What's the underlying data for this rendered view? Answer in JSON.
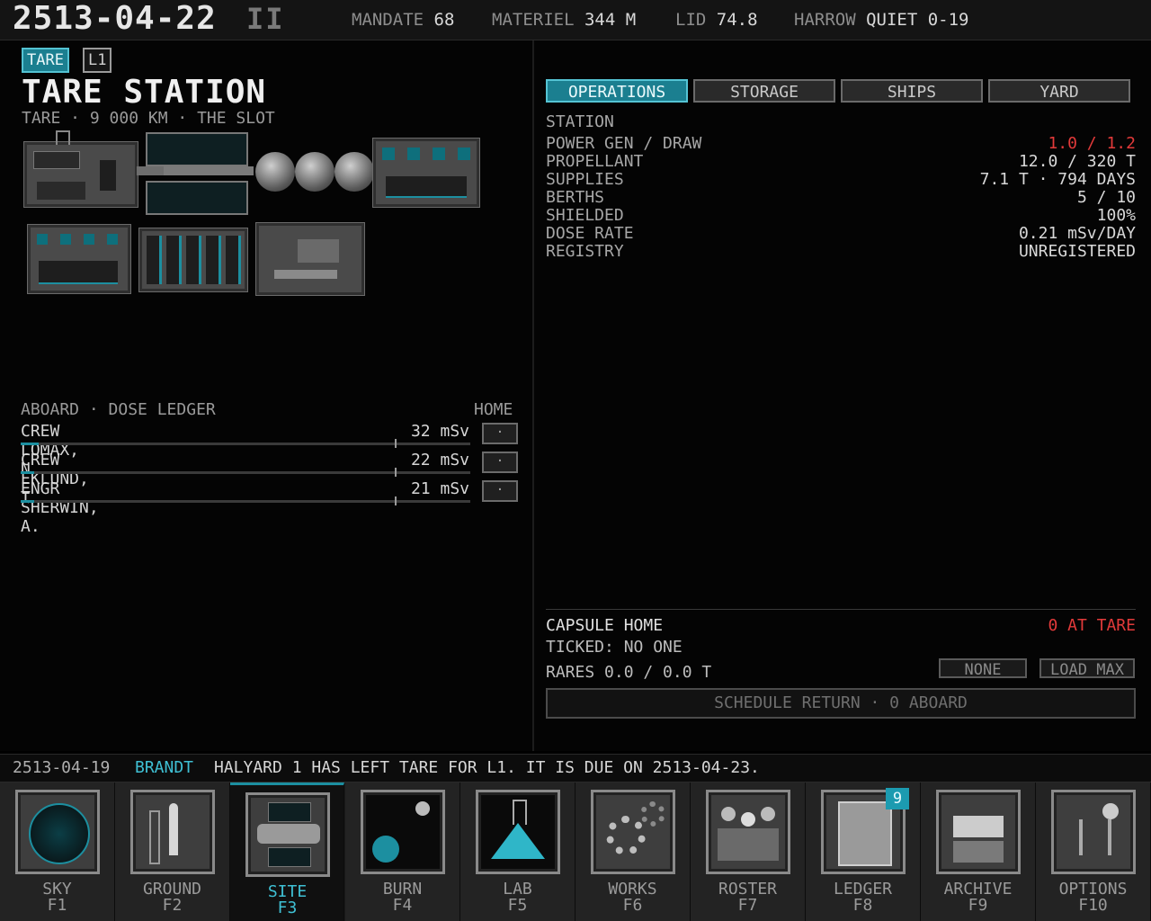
{
  "topbar": {
    "date": "2513-04-22",
    "speed_symbol": "II",
    "stats": [
      {
        "label": "MANDATE",
        "value": "68"
      },
      {
        "label": "MATERIEL",
        "value": "344 M"
      },
      {
        "label": "LID",
        "value": "74.8"
      },
      {
        "label": "HARROW",
        "value": "QUIET 0-19"
      }
    ]
  },
  "station": {
    "tags": [
      "TARE",
      "L1"
    ],
    "title": "TARE STATION",
    "subtitle": "TARE · 9 000 KM · THE SLOT"
  },
  "crew": {
    "header": "ABOARD · DOSE LEDGER",
    "home_header": "HOME",
    "rows": [
      {
        "name": "CREW LOMAX, N.",
        "dose": "32 mSv",
        "dose_fraction": 0.04,
        "home": "·"
      },
      {
        "name": "CREW EKLUND, T.",
        "dose": "22 mSv",
        "dose_fraction": 0.03,
        "home": "·"
      },
      {
        "name": "ENGR SHERWIN, A.",
        "dose": "21 mSv",
        "dose_fraction": 0.03,
        "home": "·"
      }
    ]
  },
  "tabs": [
    "OPERATIONS",
    "STORAGE",
    "SHIPS",
    "YARD"
  ],
  "active_tab": "OPERATIONS",
  "operations": {
    "section": "STATION",
    "rows": [
      {
        "label": "POWER GEN / DRAW",
        "value": "1.0 / 1.2",
        "alert": true
      },
      {
        "label": "PROPELLANT",
        "value": "12.0 / 320 T",
        "alert": false
      },
      {
        "label": "SUPPLIES",
        "value": "7.1 T · 794 DAYS",
        "alert": false
      },
      {
        "label": "BERTHS",
        "value": "5 / 10",
        "alert": false
      },
      {
        "label": "SHIELDED",
        "value": "100%",
        "alert": false
      },
      {
        "label": "DOSE RATE",
        "value": "0.21 mSv/DAY",
        "alert": false
      },
      {
        "label": "REGISTRY",
        "value": "UNREGISTERED",
        "alert": false
      }
    ]
  },
  "capsule": {
    "title": "CAPSULE HOME",
    "status": "0 AT TARE",
    "ticked": "TICKED: NO ONE",
    "rares": "RARES 0.0 / 0.0 T",
    "none_label": "NONE",
    "load_max_label": "LOAD MAX",
    "schedule_label": "SCHEDULE RETURN · 0 ABOARD"
  },
  "message": {
    "date": "2513-04-19",
    "who": "BRANDT",
    "text": "HALYARD 1 HAS LEFT TARE FOR L1. IT IS DUE ON 2513-04-23."
  },
  "dock": [
    {
      "label": "SKY",
      "key": "F1",
      "icon": "radar-icon"
    },
    {
      "label": "GROUND",
      "key": "F2",
      "icon": "launchpad-icon"
    },
    {
      "label": "SITE",
      "key": "F3",
      "icon": "station-icon"
    },
    {
      "label": "BURN",
      "key": "F4",
      "icon": "orbit-icon"
    },
    {
      "label": "LAB",
      "key": "F5",
      "icon": "flask-icon"
    },
    {
      "label": "WORKS",
      "key": "F6",
      "icon": "gears-icon"
    },
    {
      "label": "ROSTER",
      "key": "F7",
      "icon": "people-icon"
    },
    {
      "label": "LEDGER",
      "key": "F8",
      "icon": "clipboard-chart-icon",
      "badge": "9"
    },
    {
      "label": "ARCHIVE",
      "key": "F9",
      "icon": "cabinet-icon"
    },
    {
      "label": "OPTIONS",
      "key": "F10",
      "icon": "levers-icon"
    }
  ],
  "active_dock": "SITE",
  "colors": {
    "accent": "#1b7f90",
    "alert": "#e23a3a",
    "accent_text": "#3fc0d4"
  }
}
